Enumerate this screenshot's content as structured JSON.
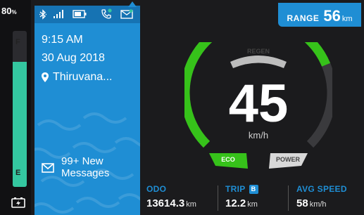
{
  "battery": {
    "percent": "80",
    "percent_unit": "%",
    "level": 0.8,
    "full_label": "F",
    "empty_label": "E",
    "icon": "battery-charging-icon",
    "fill_color": "#34c7a0"
  },
  "status_icons": [
    "bluetooth-icon",
    "signal-icon",
    "battery-icon",
    "phone-call-icon",
    "mail-icon"
  ],
  "info": {
    "time": "9:15 AM",
    "date": "30 Aug 2018",
    "location": "Thiruvana...",
    "message_line1": "99+ New",
    "message_line2": "Messages"
  },
  "range": {
    "label": "RANGE",
    "value": "56",
    "unit": "km"
  },
  "speedometer": {
    "speed": "45",
    "unit": "km/h",
    "level": 0.75,
    "arc_color": "#36c21a"
  },
  "modes": {
    "regen": "REGEN",
    "eco": "ECO",
    "power": "POWER",
    "active": "ECO"
  },
  "stats": {
    "odo": {
      "label": "ODO",
      "value": "13614.3",
      "unit": "km"
    },
    "trip": {
      "label": "TRIP",
      "badge": "B",
      "value": "12.2",
      "unit": "km"
    },
    "avg_speed": {
      "label": "AVG SPEED",
      "value": "58",
      "unit": "km/h"
    }
  },
  "colors": {
    "accent": "#1f8ed4",
    "green": "#36c21a",
    "teal": "#34c7a0",
    "background": "#1b1b1d"
  }
}
